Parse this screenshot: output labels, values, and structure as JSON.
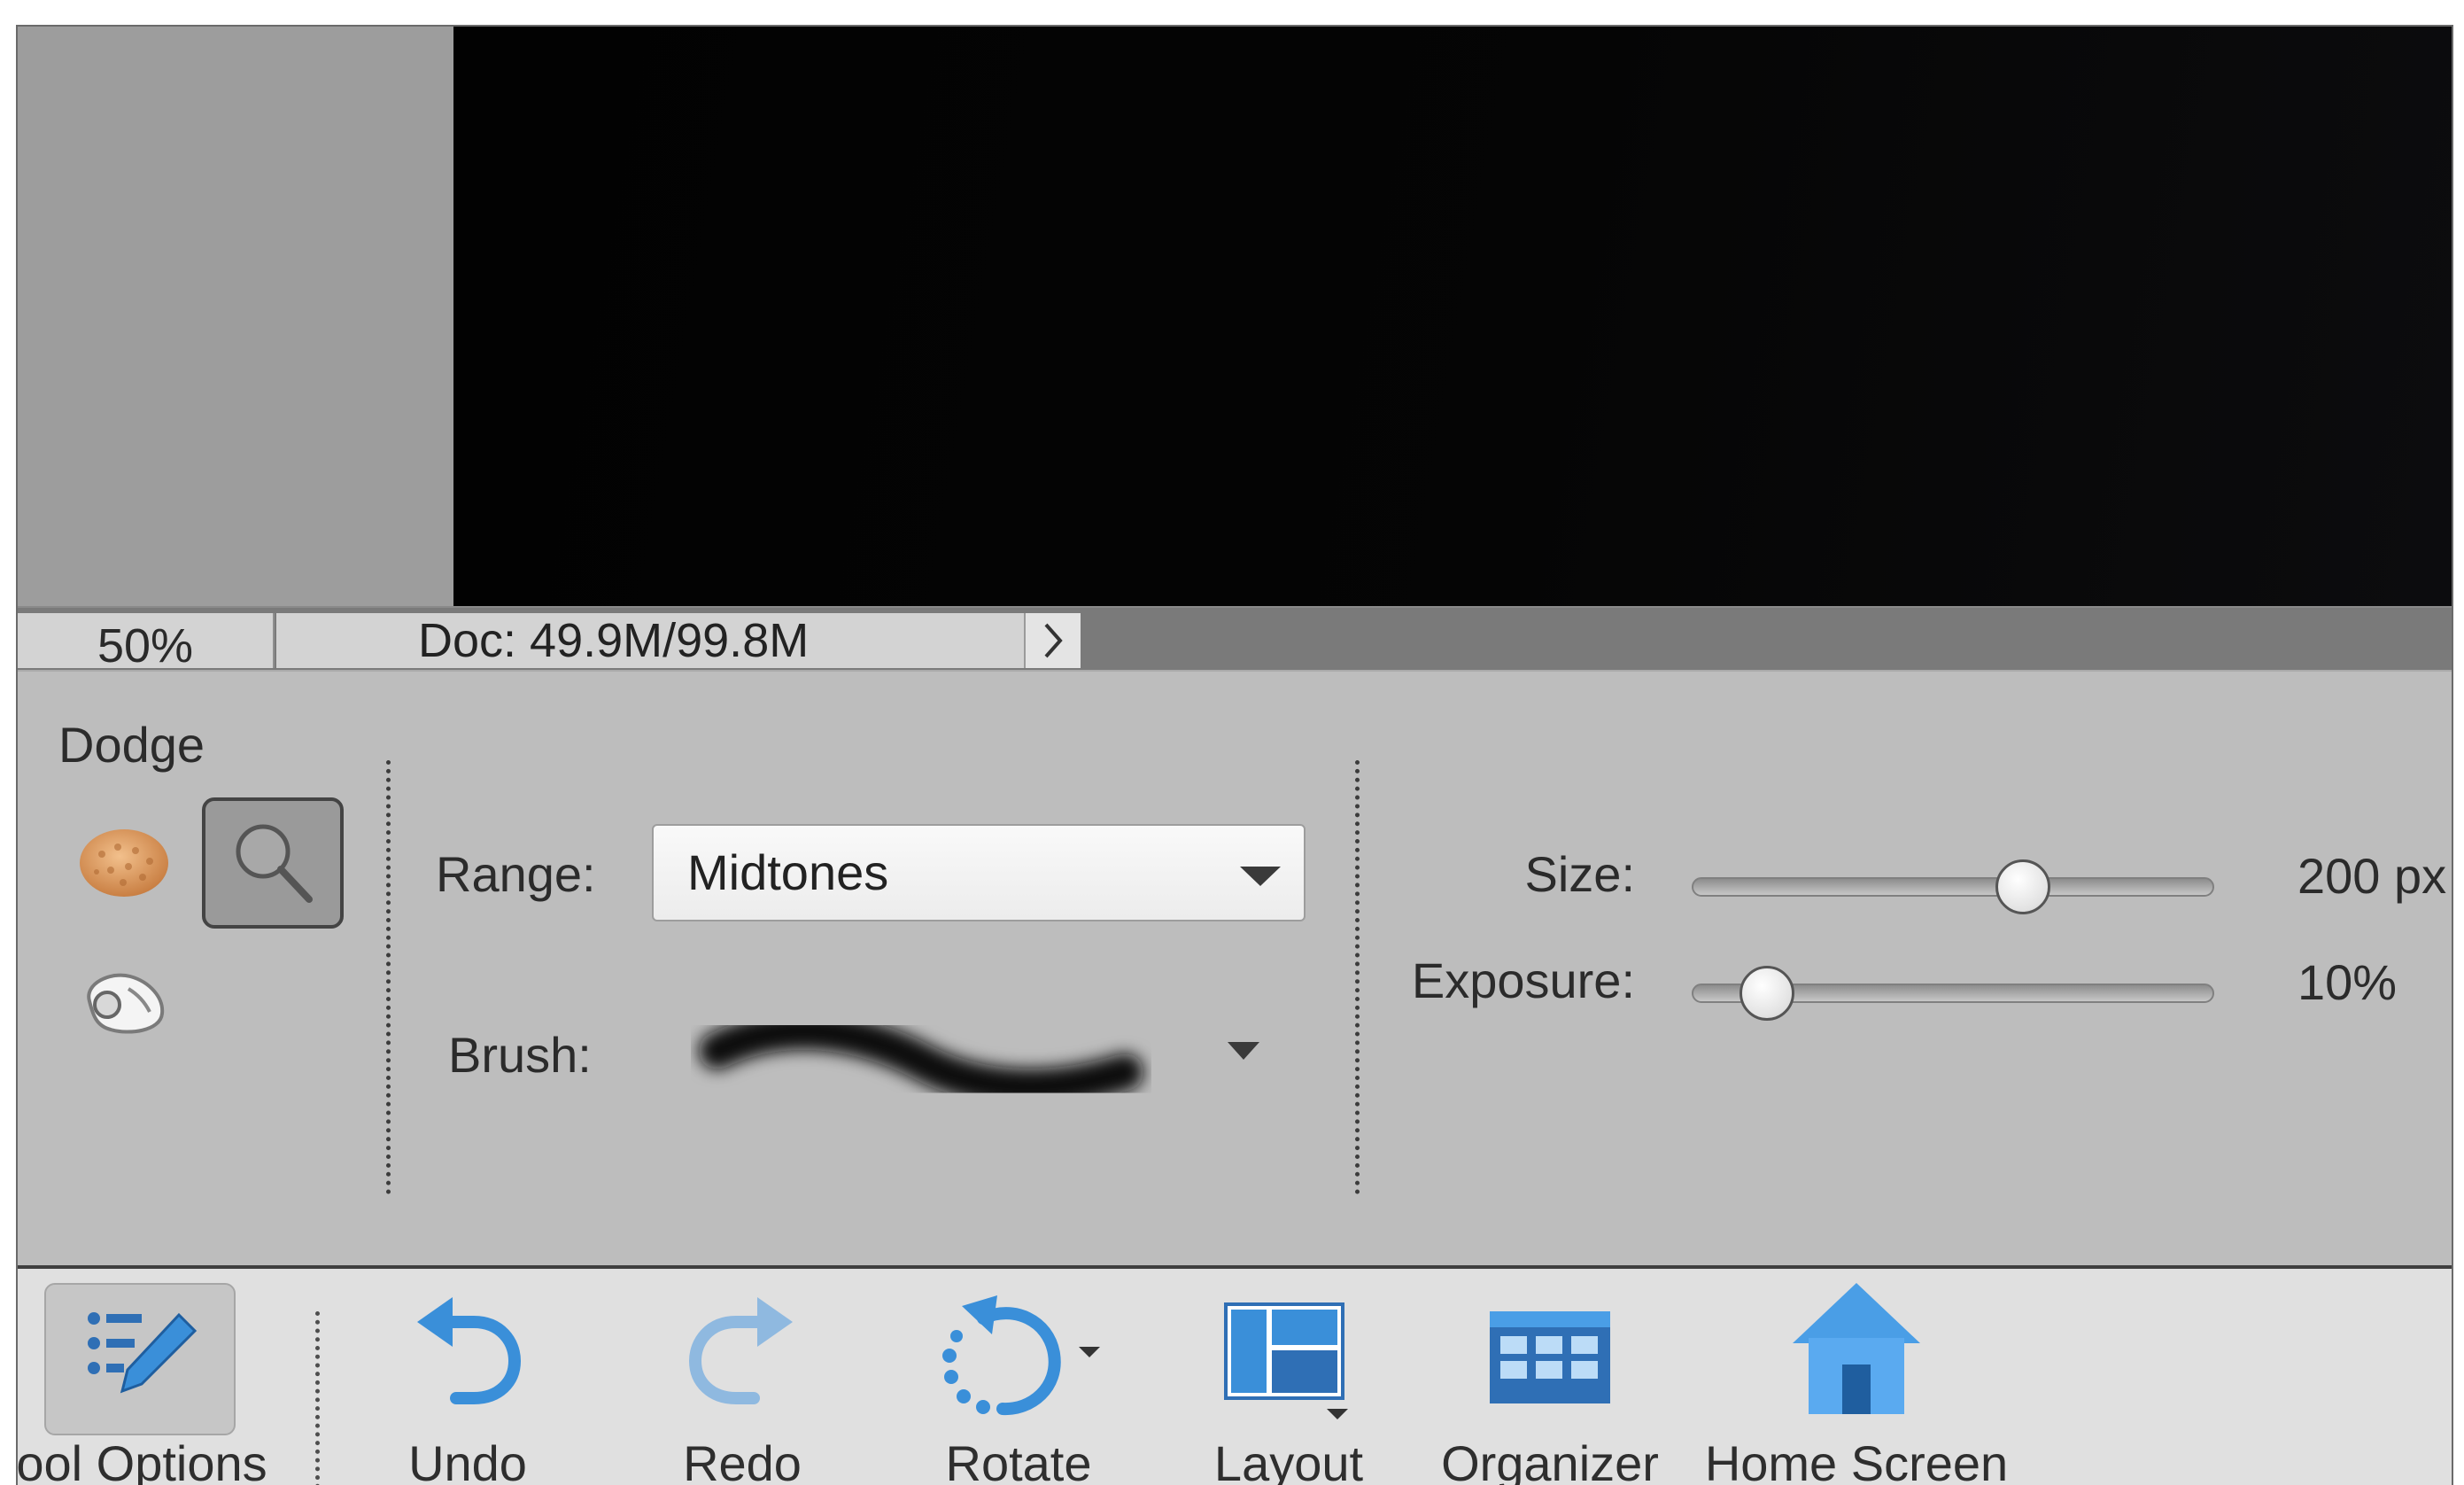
{
  "status_bar": {
    "zoom": "50%",
    "doc_info": "Doc: 49.9M/99.8M"
  },
  "tool_options": {
    "tool_name": "Dodge",
    "tools": [
      "sponge-icon",
      "dodge-icon",
      "burn-icon"
    ],
    "selected_tool": "dodge-icon",
    "range_label": "Range:",
    "range_value": "Midtones",
    "brush_label": "Brush:",
    "size_label": "Size:",
    "size_value": "200 px",
    "size_slider_fraction": 0.65,
    "exposure_label": "Exposure:",
    "exposure_value": "10%",
    "exposure_slider_fraction": 0.1
  },
  "taskbar": {
    "tool_options_label": "ool Options",
    "undo_label": "Undo",
    "redo_label": "Redo",
    "rotate_label": "Rotate",
    "layout_label": "Layout",
    "organizer_label": "Organizer",
    "home_screen_label": "Home Screen"
  },
  "colors": {
    "accent_blue": "#3a8fd9",
    "panel_gray": "#bdbdbd",
    "taskbar_gray": "#e0e0e0"
  }
}
